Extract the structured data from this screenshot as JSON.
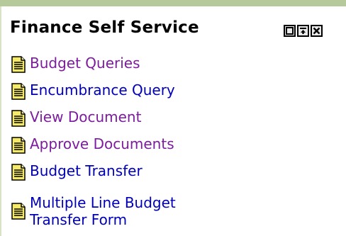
{
  "portlet": {
    "title": "Finance Self Service",
    "controls": [
      {
        "name": "minimize-button",
        "icon": "restore-icon"
      },
      {
        "name": "move-top-button",
        "icon": "move-top-icon"
      },
      {
        "name": "close-button",
        "icon": "close-icon"
      }
    ]
  },
  "links": [
    {
      "label": "Budget Queries",
      "state": "visited",
      "icon": "document-icon"
    },
    {
      "label": "Encumbrance Query",
      "state": "unvisited",
      "icon": "document-icon"
    },
    {
      "label": "View Document",
      "state": "visited",
      "icon": "document-icon"
    },
    {
      "label": "Approve Documents",
      "state": "visited",
      "icon": "document-icon"
    },
    {
      "label": "Budget Transfer",
      "state": "unvisited",
      "icon": "document-icon"
    },
    {
      "label": "Multiple Line Budget Transfer Form",
      "state": "unvisited",
      "icon": "document-icon"
    }
  ],
  "colors": {
    "header_bar": "#b5c99a",
    "visited_link": "#7d1c9e",
    "unvisited_link": "#0000b8",
    "document_icon_fill": "#f5e96a"
  }
}
